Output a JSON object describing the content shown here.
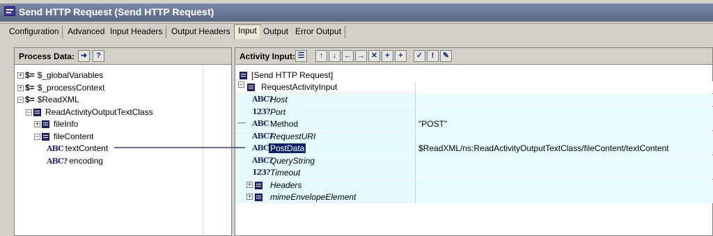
{
  "window": {
    "title": "Send HTTP Request (Send HTTP Request)"
  },
  "tabs": [
    {
      "label": "Configuration",
      "active": false
    },
    {
      "label": "Advanced",
      "active": false
    },
    {
      "label": "Input Headers",
      "active": false
    },
    {
      "label": "Output Headers",
      "active": false
    },
    {
      "label": "Input",
      "active": true
    },
    {
      "label": "Output",
      "active": false
    },
    {
      "label": "Error Output",
      "active": false
    }
  ],
  "process_data": {
    "label": "Process Data:",
    "tree": [
      {
        "label": "$_globalVariables"
      },
      {
        "label": "$_processContext"
      },
      {
        "label": "$ReadXML"
      },
      {
        "label": "ReadActivityOutputTextClass"
      },
      {
        "label": "fileInfo"
      },
      {
        "label": "fileContent"
      },
      {
        "label": "textContent"
      },
      {
        "label": "encoding"
      }
    ]
  },
  "activity_input": {
    "label": "Activity Input:",
    "root_label": "[Send HTTP Request]",
    "rows": [
      {
        "name": "RequestActivityInput",
        "value": ""
      },
      {
        "name": "Host",
        "value": ""
      },
      {
        "name": "Port",
        "value": ""
      },
      {
        "name": "Method",
        "value": "\"POST\""
      },
      {
        "name": "RequestURI",
        "value": ""
      },
      {
        "name": "PostData",
        "value": "$ReadXML/ns:ReadActivityOutputTextClass/fileContent/textContent"
      },
      {
        "name": "QueryString",
        "value": ""
      },
      {
        "name": "Timeout",
        "value": ""
      },
      {
        "name": "Headers",
        "value": ""
      },
      {
        "name": "mimeEnvelopeElement",
        "value": ""
      }
    ]
  },
  "colors": {
    "title_bar": "#5a6886",
    "mapped_row": "#e4fafc",
    "selection": "#0a246a"
  }
}
